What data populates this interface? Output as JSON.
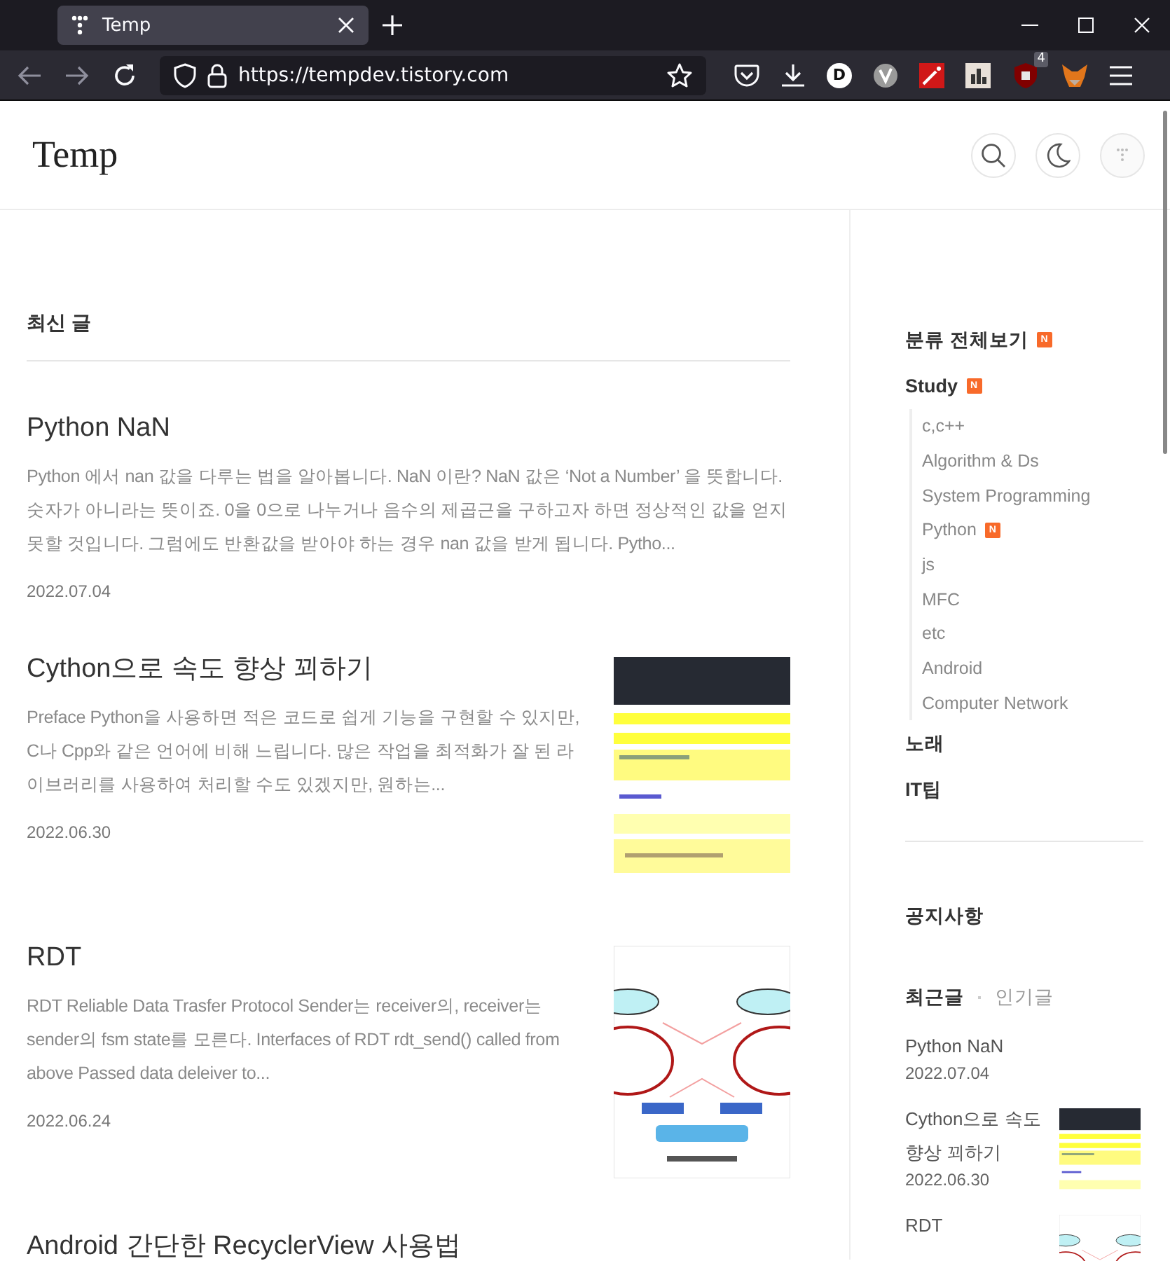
{
  "browser": {
    "tab": {
      "title": "Temp",
      "selected": true
    },
    "url": "https://tempdev.tistory.com",
    "extension_letter": "D",
    "extension_badge": "4"
  },
  "header": {
    "title": "Temp"
  },
  "main": {
    "section_title": "최신 글",
    "posts": [
      {
        "title": "Python NaN",
        "excerpt": "Python 에서 nan 값을 다루는 법을 알아봅니다. NaN 이란? NaN 값은 ‘Not a Number’ 을 뜻합니다. 숫자가 아니라는 뜻이죠. 0을 0으로 나누거나 음수의 제곱근을 구하고자 하면 정상적인 값을 얻지 못할 것입니다. 그럼에도 반환값을 받아야 하는 경우 nan 값을 받게 됩니다. Pytho...",
        "date": "2022.07.04"
      },
      {
        "title": "Cython으로 속도 향상 꾀하기",
        "excerpt": "Preface Python을 사용하면 적은 코드로 쉽게 기능을 구현할 수 있지만, C나 Cpp와 같은 언어에 비해 느립니다. 많은 작업을 최적화가 잘 된 라이브러리를 사용하여 처리할 수도 있겠지만, 원하는...",
        "date": "2022.06.30"
      },
      {
        "title": "RDT",
        "excerpt": "RDT Reliable Data Trasfer Protocol Sender는 receiver의, receiver는 sender의 fsm state를 모른다. Interfaces of RDT rdt_send() called from above Passed data deleiver to...",
        "date": "2022.06.24"
      },
      {
        "title": "Android 간단한 RecyclerView 사용법"
      }
    ]
  },
  "sidebar": {
    "categories": [
      {
        "label": "분류 전체보기",
        "badge": "N"
      },
      {
        "label": "Study",
        "badge": "N",
        "children": [
          {
            "label": "c,c++"
          },
          {
            "label": "Algorithm & Ds"
          },
          {
            "label": "System Programming"
          },
          {
            "label": "Python",
            "badge": "N"
          },
          {
            "label": "js"
          },
          {
            "label": "MFC"
          },
          {
            "label": "etc"
          },
          {
            "label": "Android"
          },
          {
            "label": "Computer Network"
          }
        ]
      },
      {
        "label": "노래"
      },
      {
        "label": "IT팁"
      }
    ],
    "notice_title": "공지사항",
    "recent_tabs": [
      {
        "label": "최근글",
        "selected": true
      },
      {
        "label": "인기글",
        "selected": false
      }
    ],
    "recent_posts": [
      {
        "title": "Python NaN",
        "date": "2022.07.04"
      },
      {
        "title": "Cython으로 속도 향상 꾀하기",
        "date": "2022.06.30"
      },
      {
        "title": "RDT"
      }
    ]
  }
}
